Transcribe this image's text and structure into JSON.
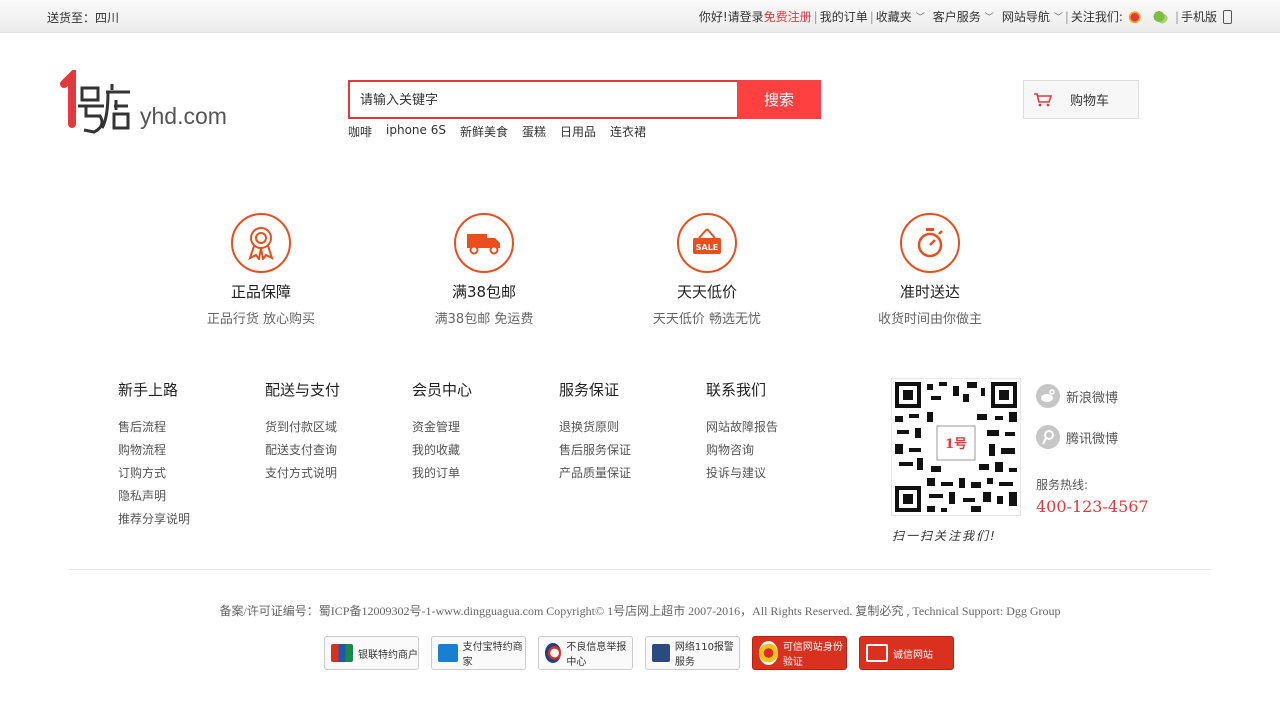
{
  "topbar": {
    "deliver_label": "送货至：",
    "deliver_region": "四川",
    "greeting": "你好!请登录",
    "register": "免费注册",
    "my_orders": "我的订单",
    "favorites": "收藏夹",
    "customer_service": "客户服务",
    "site_nav": "网站导航",
    "follow_us": "关注我们:",
    "mobile": "手机版"
  },
  "header": {
    "logo_mark": "1号店",
    "logo_domain": "yhd.com",
    "search_placeholder": "请输入关键字",
    "search_button": "搜索",
    "hot_words": [
      "咖啡",
      "iphone 6S",
      "新鲜美食",
      "蛋糕",
      "日用品",
      "连衣裙"
    ],
    "cart_label": "购物车"
  },
  "features": [
    {
      "title": "正品保障",
      "subtitle": "正品行货 放心购买",
      "icon": "award-icon"
    },
    {
      "title": "满38包邮",
      "subtitle": "满38包邮 免运费",
      "icon": "truck-icon"
    },
    {
      "title": "天天低价",
      "subtitle": "天天低价 畅选无忧",
      "icon": "sale-tag-icon"
    },
    {
      "title": "准时送达",
      "subtitle": "收货时间由你做主",
      "icon": "stopwatch-icon"
    }
  ],
  "footer_columns": [
    {
      "title": "新手上路",
      "items": [
        "售后流程",
        "购物流程",
        "订购方式",
        "隐私声明",
        "推荐分享说明"
      ]
    },
    {
      "title": "配送与支付",
      "items": [
        "货到付款区域",
        "配送支付查询",
        "支付方式说明"
      ]
    },
    {
      "title": "会员中心",
      "items": [
        "资金管理",
        "我的收藏",
        "我的订单"
      ]
    },
    {
      "title": "服务保证",
      "items": [
        "退换货原则",
        "售后服务保证",
        "产品质量保证"
      ]
    },
    {
      "title": "联系我们",
      "items": [
        "网站故障报告",
        "购物咨询",
        "投诉与建议"
      ]
    }
  ],
  "contact": {
    "qr_caption": "扫一扫关注我们!",
    "sina_weibo": "新浪微博",
    "tencent_weibo": "腾讯微博",
    "hotline_label": "服务热线:",
    "hotline_number": "400-123-4567"
  },
  "copyright": "备案/许可证编号：蜀ICP备12009302号-1-www.dingguagua.com Copyright© 1号店网上超市 2007-2016，All Rights Reserved. 复制必究 , Technical Support: Dgg Group",
  "badges": [
    {
      "label": "银联特约商户",
      "style": "light",
      "icon_color": "#1e5aa8"
    },
    {
      "label": "支付宝特约商家",
      "style": "light",
      "icon_color": "#1a7fd1"
    },
    {
      "label": "不良信息举报中心",
      "style": "light",
      "icon_color": "#d9301f"
    },
    {
      "label": "网络110报警服务",
      "style": "light",
      "icon_color": "#2a4a80"
    },
    {
      "label": "可信网站身份验证",
      "style": "red",
      "icon_color": "#f3c21a"
    },
    {
      "label": "诚信网站",
      "style": "red",
      "icon_color": "#ffffff"
    }
  ],
  "colors": {
    "brand_red": "#e4393c",
    "feature_orange": "#e94f1d"
  }
}
